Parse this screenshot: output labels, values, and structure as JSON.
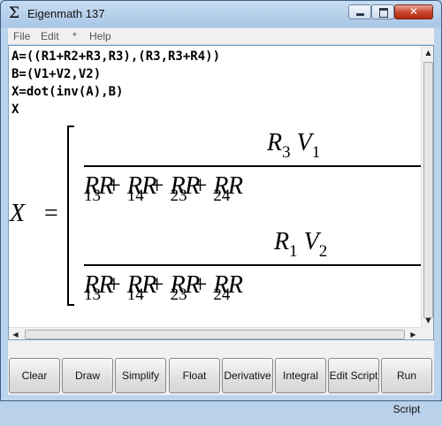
{
  "window": {
    "title": "Eigenmath 137",
    "app_icon_glyph": "Σ",
    "close_glyph": "✕"
  },
  "menu": [
    "File",
    "Edit",
    "*",
    "Help"
  ],
  "editor_lines": [
    "A=((R1+R2+R3,R3),(R3,R3+R4))",
    "B=(V1+V2,V2)",
    "X=dot(inv(A),B)",
    "X"
  ],
  "result": {
    "lhs": "X",
    "equals": "=",
    "rows": [
      {
        "numerator": [
          {
            "v": "R",
            "s": "3"
          },
          {
            "v": "V",
            "s": "1"
          }
        ],
        "denominator": "R1 R3 + R1 R4 + R2 R3 + R2 R4"
      },
      {
        "numerator": [
          {
            "v": "R",
            "s": "1"
          },
          {
            "v": "V",
            "s": "2"
          }
        ],
        "denominator": "R1 R3 + R1 R4 + R2 R3 + R2 R4"
      }
    ]
  },
  "buttons": [
    "Clear",
    "Draw",
    "Simplify",
    "Float",
    "Derivative",
    "Integral",
    "Edit Script",
    "Run Script"
  ],
  "icons": {
    "scroll_up": "▲",
    "scroll_down": "▼",
    "scroll_left": "◀",
    "scroll_right": "▶"
  }
}
